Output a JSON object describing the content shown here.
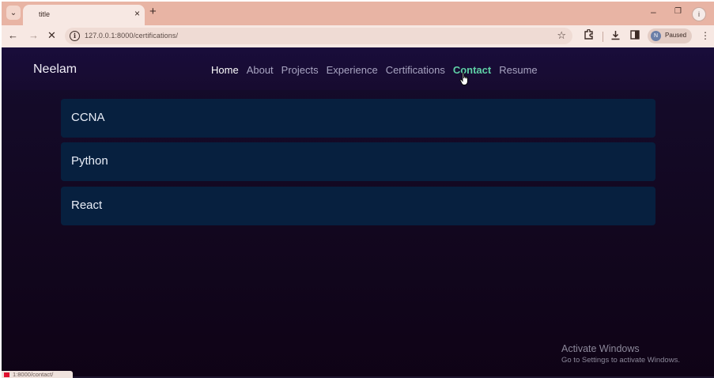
{
  "browser": {
    "tab_title": "title",
    "tab_close": "×",
    "new_tab": "+",
    "url": "127.0.0.1:8000/certifications/",
    "profile_initial": "N",
    "profile_status": "Paused",
    "status_url": "1:8000/contact/"
  },
  "site": {
    "brand": "Neelam",
    "nav": [
      "Home",
      "About",
      "Projects",
      "Experience",
      "Certifications",
      "Contact",
      "Resume"
    ],
    "active_hover": "Contact",
    "certifications": [
      "CCNA",
      "Python",
      "React"
    ]
  },
  "watermark": {
    "title": "Activate Windows",
    "subtitle": "Go to Settings to activate Windows."
  },
  "colors": {
    "tabstrip": "#e8b4a4",
    "toolbar": "#f7e8e3",
    "page_bg": "#12071f",
    "card_bg": "#07203f",
    "hover_link": "#5fd1a6"
  }
}
